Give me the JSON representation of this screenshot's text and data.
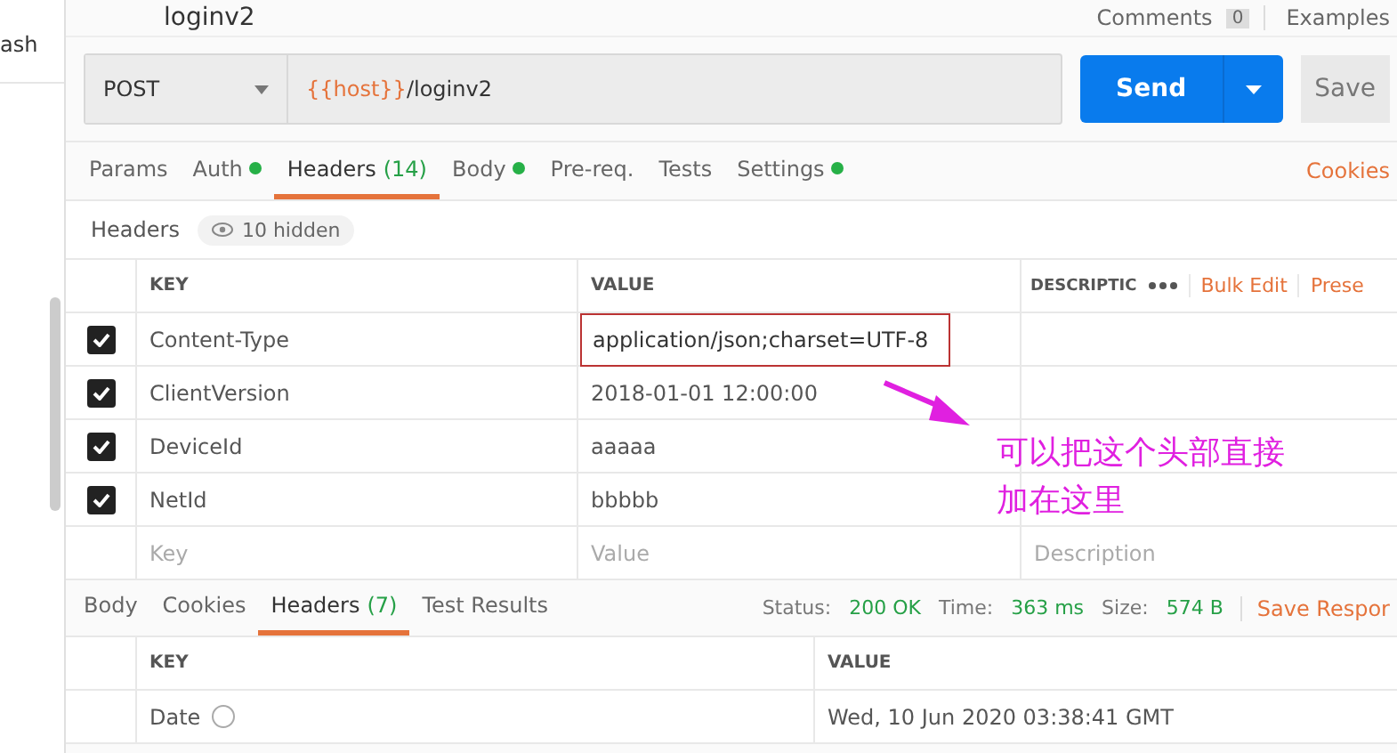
{
  "sidebar": {
    "label": "ash"
  },
  "request": {
    "title": "loginv2",
    "comments": "Comments",
    "comments_count": "0",
    "examples": "Examples",
    "method": "POST",
    "url_variable": "{{host}}",
    "url_path": "/loginv2",
    "send": "Send",
    "save": "Save"
  },
  "tabs": [
    {
      "label": "Params",
      "dot": false,
      "selected": false
    },
    {
      "label": "Auth",
      "dot": true,
      "selected": false
    },
    {
      "label": "Headers",
      "dot": false,
      "count": "(14)",
      "selected": true
    },
    {
      "label": "Body",
      "dot": true,
      "selected": false
    },
    {
      "label": "Pre-req.",
      "dot": false,
      "selected": false
    },
    {
      "label": "Tests",
      "dot": false,
      "selected": false
    },
    {
      "label": "Settings",
      "dot": true,
      "selected": false
    }
  ],
  "cookies_link": "Cookies",
  "headers_section": {
    "title": "Headers",
    "hidden": "10 hidden"
  },
  "header_table": {
    "columns": [
      "KEY",
      "VALUE",
      "DESCRIPTIC"
    ],
    "bulk_edit": "Bulk Edit",
    "presets": "Prese",
    "rows": [
      {
        "key": "Content-Type",
        "value": "application/json;charset=UTF-8",
        "checked": true,
        "editing": true
      },
      {
        "key": "ClientVersion",
        "value": "2018-01-01 12:00:00",
        "checked": true,
        "editing": false
      },
      {
        "key": "DeviceId",
        "value": "aaaaa",
        "checked": true,
        "editing": false
      },
      {
        "key": "NetId",
        "value": "bbbbb",
        "checked": true,
        "editing": false
      }
    ],
    "new_row": {
      "key": {
        "placeholder": "Key"
      },
      "value": {
        "placeholder": "Value"
      },
      "description": {
        "placeholder": "Description"
      }
    }
  },
  "annotation": {
    "lines": [
      "可以把这个头部直接",
      "加在这里"
    ]
  },
  "response": {
    "tabs": [
      {
        "label": "Body",
        "selected": false
      },
      {
        "label": "Cookies",
        "selected": false
      },
      {
        "label": "Headers",
        "count": "(7)",
        "selected": true
      },
      {
        "label": "Test Results",
        "selected": false
      }
    ],
    "stats": [
      {
        "label": "Status:",
        "value": "200 OK"
      },
      {
        "label": "Time:",
        "value": "363 ms"
      },
      {
        "label": "Size:",
        "value": "574 B"
      }
    ],
    "save_response": "Save Respor",
    "columns": [
      "KEY",
      "VALUE"
    ],
    "rows": [
      {
        "key": "Date",
        "value": "Wed, 10 Jun 2020 03:38:41 GMT"
      }
    ]
  }
}
